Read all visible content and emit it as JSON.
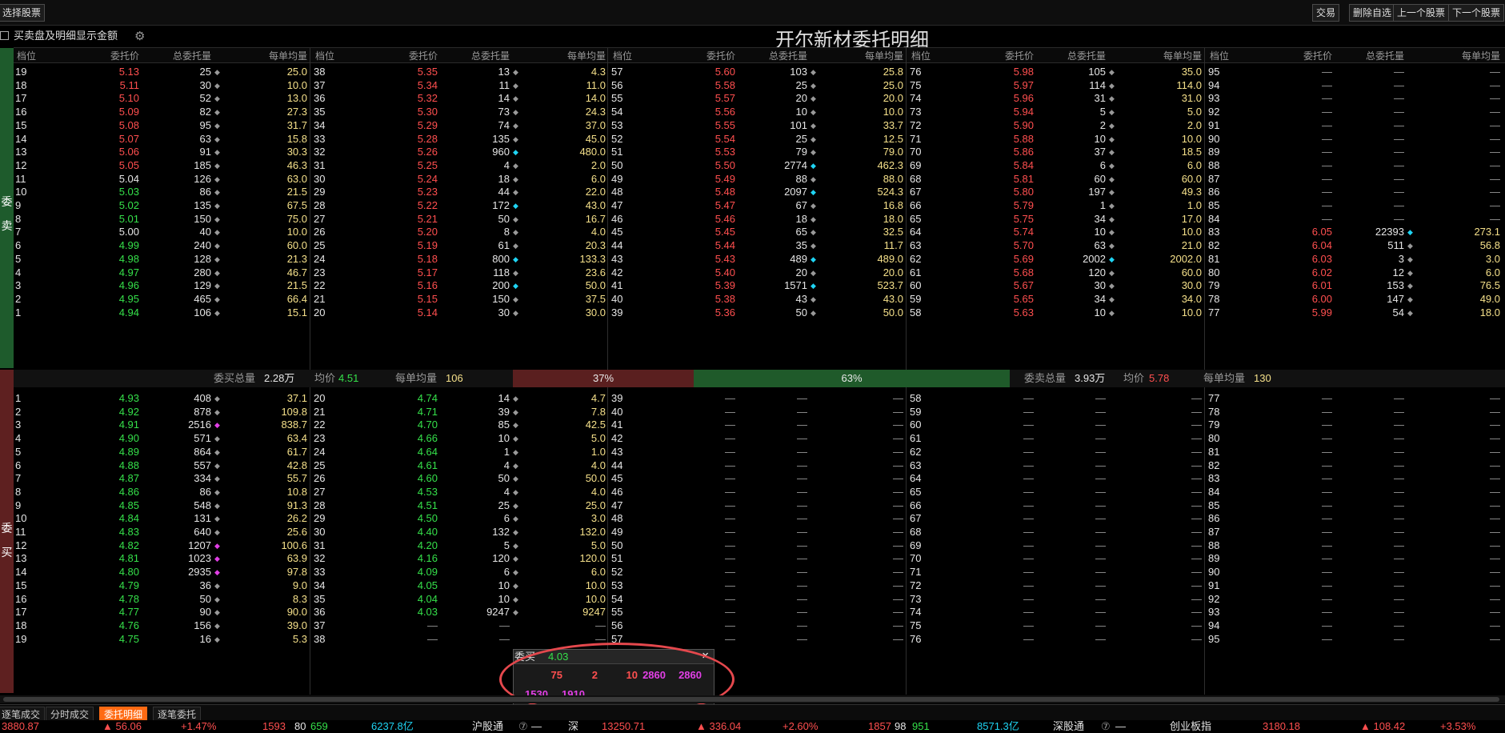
{
  "toolbar": {
    "select_stock": "选择股票",
    "trade": "交易",
    "remove_watch": "删除自选",
    "prev_stock": "上一个股票",
    "next_stock": "下一个股票"
  },
  "option_label": "买卖盘及明细显示金额",
  "title": "开尔新材委托明细",
  "side_labels": {
    "sell": "委卖",
    "buy": "委买"
  },
  "headers": [
    "档位",
    "委托价",
    "总委托量",
    "每单均量"
  ],
  "sell_cols": [
    [
      [
        "19",
        "5.13",
        "25",
        "25.0"
      ],
      [
        "18",
        "5.11",
        "30",
        "10.0"
      ],
      [
        "17",
        "5.10",
        "52",
        "13.0"
      ],
      [
        "16",
        "5.09",
        "82",
        "27.3"
      ],
      [
        "15",
        "5.08",
        "95",
        "31.7"
      ],
      [
        "14",
        "5.07",
        "63",
        "15.8"
      ],
      [
        "13",
        "5.06",
        "91",
        "30.3"
      ],
      [
        "12",
        "5.05",
        "185",
        "46.3"
      ],
      [
        "11",
        "5.04",
        "126",
        "63.0"
      ],
      [
        "10",
        "5.03",
        "86",
        "21.5"
      ],
      [
        "9",
        "5.02",
        "135",
        "67.5"
      ],
      [
        "8",
        "5.01",
        "150",
        "75.0"
      ],
      [
        "7",
        "5.00",
        "40",
        "10.0"
      ],
      [
        "6",
        "4.99",
        "240",
        "60.0"
      ],
      [
        "5",
        "4.98",
        "128",
        "21.3"
      ],
      [
        "4",
        "4.97",
        "280",
        "46.7"
      ],
      [
        "3",
        "4.96",
        "129",
        "21.5"
      ],
      [
        "2",
        "4.95",
        "465",
        "66.4"
      ],
      [
        "1",
        "4.94",
        "106",
        "15.1"
      ]
    ],
    [
      [
        "38",
        "5.35",
        "13",
        "4.3"
      ],
      [
        "37",
        "5.34",
        "11",
        "11.0"
      ],
      [
        "36",
        "5.32",
        "14",
        "14.0"
      ],
      [
        "35",
        "5.30",
        "73",
        "24.3"
      ],
      [
        "34",
        "5.29",
        "74",
        "37.0"
      ],
      [
        "33",
        "5.28",
        "135",
        "45.0"
      ],
      [
        "32",
        "5.26",
        "960",
        "480.0"
      ],
      [
        "31",
        "5.25",
        "4",
        "2.0"
      ],
      [
        "30",
        "5.24",
        "18",
        "6.0"
      ],
      [
        "29",
        "5.23",
        "44",
        "22.0"
      ],
      [
        "28",
        "5.22",
        "172",
        "43.0"
      ],
      [
        "27",
        "5.21",
        "50",
        "16.7"
      ],
      [
        "26",
        "5.20",
        "8",
        "4.0"
      ],
      [
        "25",
        "5.19",
        "61",
        "20.3"
      ],
      [
        "24",
        "5.18",
        "800",
        "133.3"
      ],
      [
        "23",
        "5.17",
        "118",
        "23.6"
      ],
      [
        "22",
        "5.16",
        "200",
        "50.0"
      ],
      [
        "21",
        "5.15",
        "150",
        "37.5"
      ],
      [
        "20",
        "5.14",
        "30",
        "30.0"
      ]
    ],
    [
      [
        "57",
        "5.60",
        "103",
        "25.8"
      ],
      [
        "56",
        "5.58",
        "25",
        "25.0"
      ],
      [
        "55",
        "5.57",
        "20",
        "20.0"
      ],
      [
        "54",
        "5.56",
        "10",
        "10.0"
      ],
      [
        "53",
        "5.55",
        "101",
        "33.7"
      ],
      [
        "52",
        "5.54",
        "25",
        "12.5"
      ],
      [
        "51",
        "5.53",
        "79",
        "79.0"
      ],
      [
        "50",
        "5.50",
        "2774",
        "462.3"
      ],
      [
        "49",
        "5.49",
        "88",
        "88.0"
      ],
      [
        "48",
        "5.48",
        "2097",
        "524.3"
      ],
      [
        "47",
        "5.47",
        "67",
        "16.8"
      ],
      [
        "46",
        "5.46",
        "18",
        "18.0"
      ],
      [
        "45",
        "5.45",
        "65",
        "32.5"
      ],
      [
        "44",
        "5.44",
        "35",
        "11.7"
      ],
      [
        "43",
        "5.43",
        "489",
        "489.0"
      ],
      [
        "42",
        "5.40",
        "20",
        "20.0"
      ],
      [
        "41",
        "5.39",
        "1571",
        "523.7"
      ],
      [
        "40",
        "5.38",
        "43",
        "43.0"
      ],
      [
        "39",
        "5.36",
        "50",
        "50.0"
      ]
    ],
    [
      [
        "76",
        "5.98",
        "105",
        "35.0"
      ],
      [
        "75",
        "5.97",
        "114",
        "114.0"
      ],
      [
        "74",
        "5.96",
        "31",
        "31.0"
      ],
      [
        "73",
        "5.94",
        "5",
        "5.0"
      ],
      [
        "72",
        "5.90",
        "2",
        "2.0"
      ],
      [
        "71",
        "5.88",
        "10",
        "10.0"
      ],
      [
        "70",
        "5.86",
        "37",
        "18.5"
      ],
      [
        "69",
        "5.84",
        "6",
        "6.0"
      ],
      [
        "68",
        "5.81",
        "60",
        "60.0"
      ],
      [
        "67",
        "5.80",
        "197",
        "49.3"
      ],
      [
        "66",
        "5.79",
        "1",
        "1.0"
      ],
      [
        "65",
        "5.75",
        "34",
        "17.0"
      ],
      [
        "64",
        "5.74",
        "10",
        "10.0"
      ],
      [
        "63",
        "5.70",
        "63",
        "21.0"
      ],
      [
        "62",
        "5.69",
        "2002",
        "2002.0"
      ],
      [
        "61",
        "5.68",
        "120",
        "60.0"
      ],
      [
        "60",
        "5.67",
        "30",
        "30.0"
      ],
      [
        "59",
        "5.65",
        "34",
        "34.0"
      ],
      [
        "58",
        "5.63",
        "10",
        "10.0"
      ]
    ],
    [
      [
        "95",
        "—",
        "—",
        "—"
      ],
      [
        "94",
        "—",
        "—",
        "—"
      ],
      [
        "93",
        "—",
        "—",
        "—"
      ],
      [
        "92",
        "—",
        "—",
        "—"
      ],
      [
        "91",
        "—",
        "—",
        "—"
      ],
      [
        "90",
        "—",
        "—",
        "—"
      ],
      [
        "89",
        "—",
        "—",
        "—"
      ],
      [
        "88",
        "—",
        "—",
        "—"
      ],
      [
        "87",
        "—",
        "—",
        "—"
      ],
      [
        "86",
        "—",
        "—",
        "—"
      ],
      [
        "85",
        "—",
        "—",
        "—"
      ],
      [
        "84",
        "—",
        "—",
        "—"
      ],
      [
        "83",
        "6.05",
        "22393",
        "273.1"
      ],
      [
        "82",
        "6.04",
        "511",
        "56.8"
      ],
      [
        "81",
        "6.03",
        "3",
        "3.0"
      ],
      [
        "80",
        "6.02",
        "12",
        "6.0"
      ],
      [
        "79",
        "6.01",
        "153",
        "76.5"
      ],
      [
        "78",
        "6.00",
        "147",
        "49.0"
      ],
      [
        "77",
        "5.99",
        "54",
        "18.0"
      ]
    ]
  ],
  "sell_price_white": [
    "5.04",
    "5.00"
  ],
  "summary": {
    "buy_total_label": "委买总量",
    "buy_total": "2.28万",
    "buy_avg_label": "均价",
    "buy_avg": "4.51",
    "buy_per_label": "每单均量",
    "buy_per": "106",
    "buy_pct": "37%",
    "sell_pct": "63%",
    "sell_total_label": "委卖总量",
    "sell_total": "3.93万",
    "sell_avg_label": "均价",
    "sell_avg": "5.78",
    "sell_per_label": "每单均量",
    "sell_per": "130"
  },
  "bar_split": {
    "buy_fraction": 0.37,
    "sell_fraction": 0.63
  },
  "buy_cols": [
    [
      [
        "1",
        "4.93",
        "408",
        "37.1"
      ],
      [
        "2",
        "4.92",
        "878",
        "109.8"
      ],
      [
        "3",
        "4.91",
        "2516",
        "838.7"
      ],
      [
        "4",
        "4.90",
        "571",
        "63.4"
      ],
      [
        "5",
        "4.89",
        "864",
        "61.7"
      ],
      [
        "6",
        "4.88",
        "557",
        "42.8"
      ],
      [
        "7",
        "4.87",
        "334",
        "55.7"
      ],
      [
        "8",
        "4.86",
        "86",
        "10.8"
      ],
      [
        "9",
        "4.85",
        "548",
        "91.3"
      ],
      [
        "10",
        "4.84",
        "131",
        "26.2"
      ],
      [
        "11",
        "4.83",
        "640",
        "25.6"
      ],
      [
        "12",
        "4.82",
        "1207",
        "100.6"
      ],
      [
        "13",
        "4.81",
        "1023",
        "63.9"
      ],
      [
        "14",
        "4.80",
        "2935",
        "97.8"
      ],
      [
        "15",
        "4.79",
        "36",
        "9.0"
      ],
      [
        "16",
        "4.78",
        "50",
        "8.3"
      ],
      [
        "17",
        "4.77",
        "90",
        "90.0"
      ],
      [
        "18",
        "4.76",
        "156",
        "39.0"
      ],
      [
        "19",
        "4.75",
        "16",
        "5.3"
      ]
    ],
    [
      [
        "20",
        "4.74",
        "14",
        "4.7"
      ],
      [
        "21",
        "4.71",
        "39",
        "7.8"
      ],
      [
        "22",
        "4.70",
        "85",
        "42.5"
      ],
      [
        "23",
        "4.66",
        "10",
        "5.0"
      ],
      [
        "24",
        "4.64",
        "1",
        "1.0"
      ],
      [
        "25",
        "4.61",
        "4",
        "4.0"
      ],
      [
        "26",
        "4.60",
        "50",
        "50.0"
      ],
      [
        "27",
        "4.53",
        "4",
        "4.0"
      ],
      [
        "28",
        "4.51",
        "25",
        "25.0"
      ],
      [
        "29",
        "4.50",
        "6",
        "3.0"
      ],
      [
        "30",
        "4.40",
        "132",
        "132.0"
      ],
      [
        "31",
        "4.20",
        "5",
        "5.0"
      ],
      [
        "32",
        "4.16",
        "120",
        "120.0"
      ],
      [
        "33",
        "4.09",
        "6",
        "6.0"
      ],
      [
        "34",
        "4.05",
        "10",
        "10.0"
      ],
      [
        "35",
        "4.04",
        "10",
        "10.0"
      ],
      [
        "36",
        "4.03",
        "9247",
        "9247"
      ],
      [
        "37",
        "—",
        "—",
        "—"
      ],
      [
        "38",
        "—",
        "—",
        "—"
      ]
    ],
    [
      [
        "39",
        "—",
        "—",
        "—"
      ],
      [
        "40",
        "—",
        "—",
        "—"
      ],
      [
        "41",
        "—",
        "—",
        "—"
      ],
      [
        "42",
        "—",
        "—",
        "—"
      ],
      [
        "43",
        "—",
        "—",
        "—"
      ],
      [
        "44",
        "—",
        "—",
        "—"
      ],
      [
        "45",
        "—",
        "—",
        "—"
      ],
      [
        "46",
        "—",
        "—",
        "—"
      ],
      [
        "47",
        "—",
        "—",
        "—"
      ],
      [
        "48",
        "—",
        "—",
        "—"
      ],
      [
        "49",
        "—",
        "—",
        "—"
      ],
      [
        "50",
        "—",
        "—",
        "—"
      ],
      [
        "51",
        "—",
        "—",
        "—"
      ],
      [
        "52",
        "—",
        "—",
        "—"
      ],
      [
        "53",
        "—",
        "—",
        "—"
      ],
      [
        "54",
        "—",
        "—",
        "—"
      ],
      [
        "55",
        "—",
        "—",
        "—"
      ],
      [
        "56",
        "—",
        "—",
        "—"
      ],
      [
        "57",
        "—",
        "—",
        "—"
      ]
    ],
    [
      [
        "58",
        "—",
        "—",
        "—"
      ],
      [
        "59",
        "—",
        "—",
        "—"
      ],
      [
        "60",
        "—",
        "—",
        "—"
      ],
      [
        "61",
        "—",
        "—",
        "—"
      ],
      [
        "62",
        "—",
        "—",
        "—"
      ],
      [
        "63",
        "—",
        "—",
        "—"
      ],
      [
        "64",
        "—",
        "—",
        "—"
      ],
      [
        "65",
        "—",
        "—",
        "—"
      ],
      [
        "66",
        "—",
        "—",
        "—"
      ],
      [
        "67",
        "—",
        "—",
        "—"
      ],
      [
        "68",
        "—",
        "—",
        "—"
      ],
      [
        "69",
        "—",
        "—",
        "—"
      ],
      [
        "70",
        "—",
        "—",
        "—"
      ],
      [
        "71",
        "—",
        "—",
        "—"
      ],
      [
        "72",
        "—",
        "—",
        "—"
      ],
      [
        "73",
        "—",
        "—",
        "—"
      ],
      [
        "74",
        "—",
        "—",
        "—"
      ],
      [
        "75",
        "—",
        "—",
        "—"
      ],
      [
        "76",
        "—",
        "—",
        "—"
      ]
    ],
    [
      [
        "77",
        "—",
        "—",
        "—"
      ],
      [
        "78",
        "—",
        "—",
        "—"
      ],
      [
        "79",
        "—",
        "—",
        "—"
      ],
      [
        "80",
        "—",
        "—",
        "—"
      ],
      [
        "81",
        "—",
        "—",
        "—"
      ],
      [
        "82",
        "—",
        "—",
        "—"
      ],
      [
        "83",
        "—",
        "—",
        "—"
      ],
      [
        "84",
        "—",
        "—",
        "—"
      ],
      [
        "85",
        "—",
        "—",
        "—"
      ],
      [
        "86",
        "—",
        "—",
        "—"
      ],
      [
        "87",
        "—",
        "—",
        "—"
      ],
      [
        "88",
        "—",
        "—",
        "—"
      ],
      [
        "89",
        "—",
        "—",
        "—"
      ],
      [
        "90",
        "—",
        "—",
        "—"
      ],
      [
        "91",
        "—",
        "—",
        "—"
      ],
      [
        "92",
        "—",
        "—",
        "—"
      ],
      [
        "93",
        "—",
        "—",
        "—"
      ],
      [
        "94",
        "—",
        "—",
        "—"
      ],
      [
        "95",
        "—",
        "—",
        "—"
      ]
    ]
  ],
  "popup": {
    "title": "委买",
    "price": "4.03",
    "close": "×",
    "row1": [
      "75",
      "2",
      "10",
      "2860",
      "2860"
    ],
    "row2": [
      "1530",
      "1910"
    ]
  },
  "tabs": [
    "逐笔成交",
    "分时成交",
    "委托明细",
    "逐笔委托"
  ],
  "active_tab": "委托明细",
  "status": [
    "3880.87",
    "▲ 56.06",
    "+1.47%",
    "1593",
    "80",
    "659",
    "6237.8亿",
    "沪股通",
    "⑦",
    "—",
    "深",
    "13250.71",
    "▲ 336.04",
    "+2.60%",
    "1857",
    "98",
    "951",
    "8571.3亿",
    "深股通",
    "⑦",
    "—",
    "创业板指",
    "3180.18",
    "▲ 108.42",
    "+3.53%"
  ],
  "colors": {
    "up": "#ff4f4f",
    "down": "#35e04a",
    "flat": "#e6e6e6",
    "volume": "#f5e08a",
    "large_order_cyan": "#1fd4f3",
    "large_order_magenta": "#e23fe6",
    "sell_side_bar": "#1f5a2a",
    "buy_side_bar": "#5a1f1f",
    "active_tab": "#ff6a13"
  }
}
